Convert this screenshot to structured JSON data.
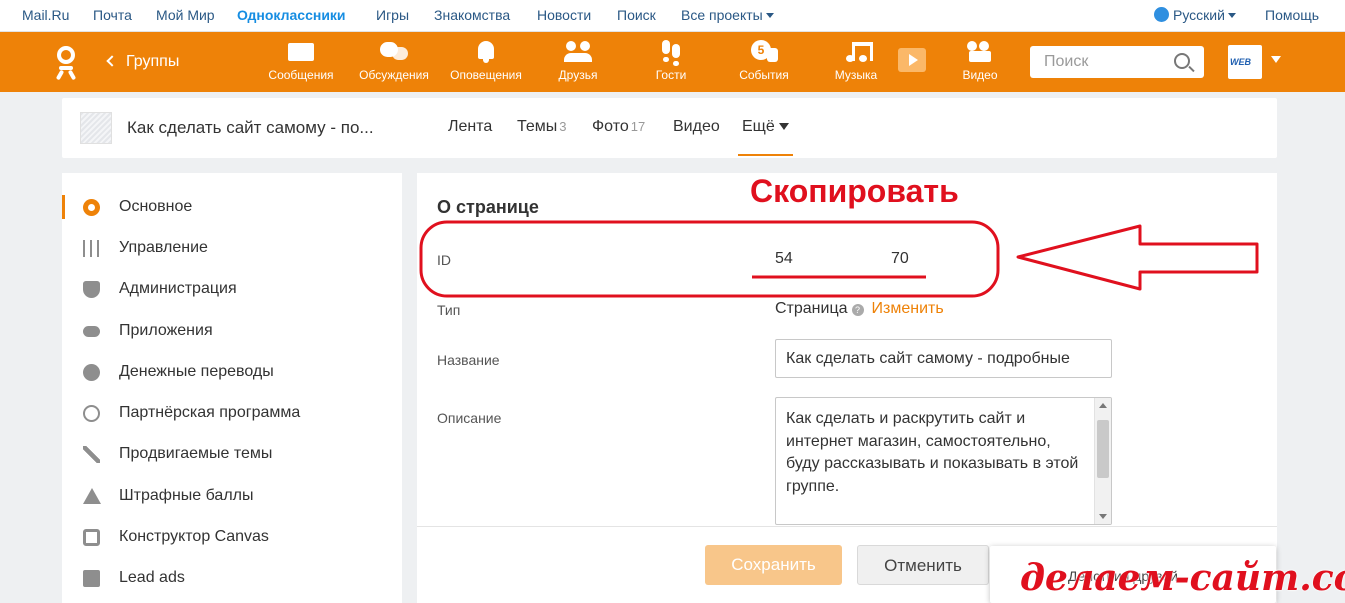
{
  "portal": {
    "links": [
      {
        "label": "Mail.Ru"
      },
      {
        "label": "Почта"
      },
      {
        "label": "Мой Мир"
      },
      {
        "label": "Одноклассники",
        "active": true
      },
      {
        "label": "Игры"
      },
      {
        "label": "Знакомства"
      },
      {
        "label": "Новости"
      },
      {
        "label": "Поиск"
      },
      {
        "label": "Все проекты"
      }
    ],
    "language": "Русский",
    "help": "Помощь"
  },
  "toolbar": {
    "back_label": "Группы",
    "nav": [
      {
        "label": "Сообщения",
        "icon": "envelope-icon"
      },
      {
        "label": "Обсуждения",
        "icon": "chat-icon"
      },
      {
        "label": "Оповещения",
        "icon": "bell-icon"
      },
      {
        "label": "Друзья",
        "icon": "users-icon"
      },
      {
        "label": "Гости",
        "icon": "footprints-icon"
      },
      {
        "label": "События",
        "icon": "events-icon",
        "badge": "5"
      },
      {
        "label": "Музыка",
        "icon": "music-note-icon"
      },
      {
        "label": "Видео",
        "icon": "video-camera-icon"
      }
    ],
    "search_placeholder": "Поиск",
    "avatar_text": "WEB"
  },
  "group": {
    "title": "Как сделать сайт самому - по...",
    "tabs": [
      {
        "label": "Лента",
        "count": ""
      },
      {
        "label": "Темы",
        "count": "3"
      },
      {
        "label": "Фото",
        "count": "17"
      },
      {
        "label": "Видео",
        "count": ""
      },
      {
        "label": "Ещё",
        "count": "",
        "active": true
      }
    ]
  },
  "sidebar": {
    "items": [
      {
        "label": "Основное",
        "icon": "gear-icon",
        "active": true
      },
      {
        "label": "Управление",
        "icon": "sliders-icon"
      },
      {
        "label": "Администрация",
        "icon": "shield-icon"
      },
      {
        "label": "Приложения",
        "icon": "gamepad-icon"
      },
      {
        "label": "Денежные переводы",
        "icon": "ruble-icon"
      },
      {
        "label": "Партнёрская программа",
        "icon": "at-sign-icon"
      },
      {
        "label": "Продвигаемые темы",
        "icon": "promote-arrow-icon"
      },
      {
        "label": "Штрафные баллы",
        "icon": "warning-icon"
      },
      {
        "label": "Конструктор Canvas",
        "icon": "canvas-icon"
      },
      {
        "label": "Lead ads",
        "icon": "lead-ads-icon"
      }
    ]
  },
  "about": {
    "title": "О странице",
    "id_label": "ID",
    "id_part1": "54",
    "id_part2": "70",
    "type_label": "Тип",
    "type_value": "Страница",
    "type_help": "?",
    "type_change": "Изменить",
    "name_label": "Название",
    "name_value": "Как сделать сайт самому - подробные",
    "desc_label": "Описание",
    "desc_value": "Как сделать и раскрутить сайт и интернет магазин, самостоятельно, буду рассказывать и показывать в этой группе.",
    "save": "Сохранить",
    "cancel": "Отменить",
    "friends_action": "Действия друзей"
  },
  "annotation": {
    "caption": "Скопировать",
    "color": "#e0101e",
    "watermark": "делаем-сайт.com"
  },
  "colors": {
    "accent": "#ee8208",
    "link": "#2a5885",
    "annotation": "#e0101e"
  }
}
